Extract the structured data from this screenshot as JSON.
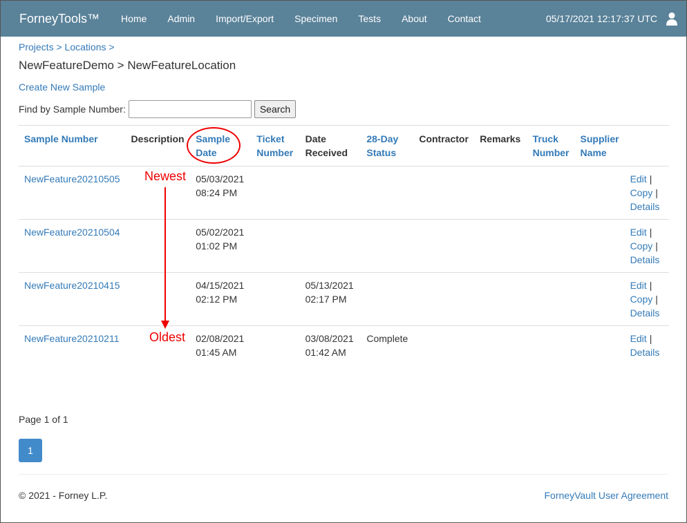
{
  "navbar": {
    "brand": "ForneyTools™",
    "items": [
      "Home",
      "Admin",
      "Import/Export",
      "Specimen",
      "Tests",
      "About",
      "Contact"
    ],
    "datetime": "05/17/2021 12:17:37 UTC",
    "user_icon": "user-icon"
  },
  "breadcrumb": {
    "projects": "Projects",
    "sep1": ">",
    "locations": "Locations",
    "sep2": ">"
  },
  "title": "NewFeatureDemo > NewFeatureLocation",
  "create_link": "Create New Sample",
  "search": {
    "label": "Find by Sample Number:",
    "value": "",
    "placeholder": "",
    "button": "Search"
  },
  "table": {
    "headers": [
      {
        "text": "Sample Number",
        "link": true
      },
      {
        "text": "Description",
        "link": false
      },
      {
        "text": "Sample Date",
        "link": true
      },
      {
        "text": "Ticket Number",
        "link": true
      },
      {
        "text": "Date Received",
        "link": false
      },
      {
        "text": "28-Day Status",
        "link": true
      },
      {
        "text": "Contractor",
        "link": false
      },
      {
        "text": "Remarks",
        "link": false
      },
      {
        "text": "Truck Number",
        "link": true
      },
      {
        "text": "Supplier Name",
        "link": true
      },
      {
        "text": "",
        "link": false
      }
    ],
    "rows": [
      {
        "sample_number": "NewFeature20210505",
        "description": "",
        "sample_date": "05/03/2021",
        "sample_time": "08:24 PM",
        "ticket_number": "",
        "date_received": "",
        "received_time": "",
        "status_28day": "",
        "contractor": "",
        "remarks": "",
        "truck_number": "",
        "supplier_name": "",
        "actions": [
          "Edit",
          "Copy",
          "Details"
        ]
      },
      {
        "sample_number": "NewFeature20210504",
        "description": "",
        "sample_date": "05/02/2021",
        "sample_time": "01:02 PM",
        "ticket_number": "",
        "date_received": "",
        "received_time": "",
        "status_28day": "",
        "contractor": "",
        "remarks": "",
        "truck_number": "",
        "supplier_name": "",
        "actions": [
          "Edit",
          "Copy",
          "Details"
        ]
      },
      {
        "sample_number": "NewFeature20210415",
        "description": "",
        "sample_date": "04/15/2021",
        "sample_time": "02:12 PM",
        "ticket_number": "",
        "date_received": "05/13/2021",
        "received_time": "02:17 PM",
        "status_28day": "",
        "contractor": "",
        "remarks": "",
        "truck_number": "",
        "supplier_name": "",
        "actions": [
          "Edit",
          "Copy",
          "Details"
        ]
      },
      {
        "sample_number": "NewFeature20210211",
        "description": "",
        "sample_date": "02/08/2021",
        "sample_time": "01:45 AM",
        "ticket_number": "",
        "date_received": "03/08/2021",
        "received_time": "01:42 AM",
        "status_28day": "Complete",
        "contractor": "",
        "remarks": "",
        "truck_number": "",
        "supplier_name": "",
        "actions": [
          "Edit",
          "Details"
        ]
      }
    ],
    "action_sep": "|"
  },
  "pager": {
    "text_prefix": "Page ",
    "current": "1",
    "text_of": " of ",
    "total": "1",
    "button": "1"
  },
  "footer": {
    "copyright": "© 2021 - Forney L.P.",
    "agreement": "ForneyVault User Agreement"
  },
  "annotations": {
    "newest": "Newest",
    "oldest": "Oldest"
  },
  "colors": {
    "navbar": "#5a8299",
    "link": "#337ab7",
    "annotation": "#e00000",
    "page_button": "#428bca"
  }
}
